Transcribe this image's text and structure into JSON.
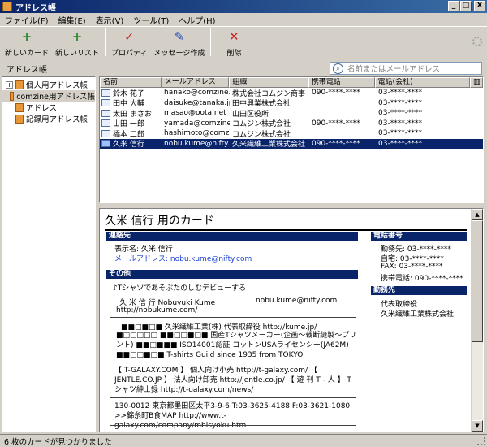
{
  "window": {
    "title": "アドレス帳",
    "minimize": "_",
    "maximize": "□",
    "close": "X"
  },
  "menu": [
    "ファイル(F)",
    "編集(E)",
    "表示(V)",
    "ツール(T)",
    "ヘルプ(H)"
  ],
  "toolbar": [
    {
      "label": "新しいカード",
      "icon": "new-card-icon",
      "glyph": "+",
      "color": "#2a8a2a"
    },
    {
      "label": "新しいリスト",
      "icon": "new-list-icon",
      "glyph": "+",
      "color": "#2a8a2a"
    },
    {
      "label": "プロパティ",
      "icon": "properties-icon",
      "glyph": "✓",
      "color": "#c03030"
    },
    {
      "label": "メッセージ作成",
      "icon": "compose-icon",
      "glyph": "✎",
      "color": "#3050b0"
    },
    {
      "label": "削除",
      "icon": "delete-icon",
      "glyph": "✕",
      "color": "#d02020"
    }
  ],
  "pane_title": "アドレス帳",
  "search": {
    "placeholder": "名前またはメールアドレス"
  },
  "tree": [
    {
      "label": "個人用アドレス帳",
      "expander": "+"
    },
    {
      "label": "comzine用アドレス帳",
      "selected": true
    },
    {
      "label": "アドレス"
    },
    {
      "label": "記録用アドレス帳"
    }
  ],
  "list": {
    "columns": [
      "名前",
      "メールアドレス",
      "組織",
      "携帯電話",
      "電話(会社)"
    ],
    "rows": [
      {
        "name": "鈴木 花子",
        "email": "hanako@comzine.co...",
        "org": "株式会社コムジン商事",
        "mobile": "090-****-****",
        "phone": "03-****-****"
      },
      {
        "name": "田中 大輔",
        "email": "daisuke@tanaka.jp",
        "org": "田中興業株式会社",
        "mobile": "",
        "phone": "03-****-****"
      },
      {
        "name": "太田 まさお",
        "email": "masao@oota.net",
        "org": "山田区役所",
        "mobile": "",
        "phone": "03-****-****"
      },
      {
        "name": "山田 一郎",
        "email": "yamada@comzine.net",
        "org": "コムジン株式会社",
        "mobile": "090-****-****",
        "phone": "03-****-****"
      },
      {
        "name": "橋本 二郎",
        "email": "hashimoto@comzine...",
        "org": "コムジン株式会社",
        "mobile": "",
        "phone": "03-****-****"
      },
      {
        "name": "久米 信行",
        "email": "nobu.kume@nifty.com",
        "org": "久米繊維工業株式会社",
        "mobile": "090-****-****",
        "phone": "03-****-****",
        "selected": true
      }
    ]
  },
  "card": {
    "title": "久米 信行 用のカード",
    "contact_head": "連絡先",
    "display_name": "表示名: 久米 信行",
    "email_label": "メールアドレス:",
    "email": "nobu.kume@nifty.com",
    "other_head": "その他",
    "memo_1": "♪Tシャツであそぶたのしむデビューする",
    "memo_2a": "久 米 信 行 Nobuyuki Kume",
    "memo_2b": "nobu.kume@nifty.com",
    "memo_2c": "http://nobukume.com/",
    "memo_3": "■■□■□■ 久米繊維工業(株) 代表取締役 http://kume.jp/",
    "memo_4": "■□□□□□ ■■□□■□■ 国産Tシャツメーカー(企画〜裁断縫製〜プリント) ■■□■■■ ISO14001認証 コットンUSAライセンシー(JA62M) ■■□□■□■ T-shirts Guild since 1935 from TOKYO",
    "memo_5": "【 T-GALAXY.COM 】 個人向け小売 http://t-galaxy.com/ 【 JENTLE.CO.JP 】 法人向け卸売 http://jentle.co.jp/ 【 遊 刊 T - 人 】 Tシャツ紳士録 http://t-galaxy.com/news/",
    "memo_6": "130-0012 東京都墨田区太平3-9-6 T:03-3625-4188 F:03-3621-1080 >>錦糸町B食MAP http://www.t-galaxy.com/company/mbisyoku.htm",
    "phone_head": "電話番号",
    "phone_work": "勤務先: 03-****-****",
    "phone_home": "自宅: 03-****-****",
    "phone_fax": "FAX: 03-****-****",
    "phone_mobile": "携帯電話: 090-****-****",
    "work_head": "勤務先",
    "work_title": "代表取締役",
    "work_org": "久米繊維工業株式会社"
  },
  "status": "6 枚のカードが見つかりました"
}
